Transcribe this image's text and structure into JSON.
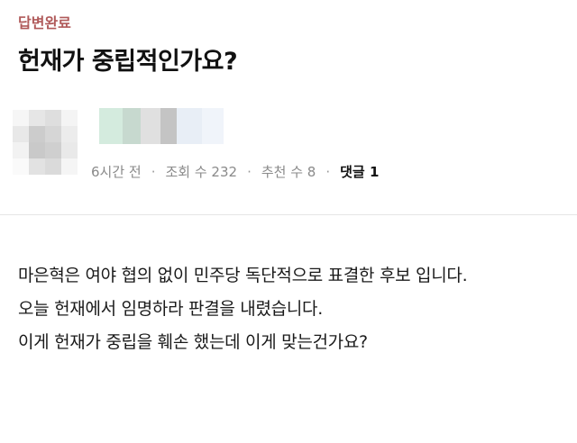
{
  "post": {
    "status_badge": "답변완료",
    "title": "헌재가 중립적인가요?",
    "meta": {
      "time": "6시간 전",
      "views": "조회 수 232",
      "recommends": "추천 수 8",
      "comments": "댓글 1"
    },
    "body": [
      "마은혁은 여야 협의 없이 민주당 독단적으로 표결한 후보 입니다.",
      "오늘 헌재에서 임명하라 판결을 내렸습니다.",
      "이게 헌재가 중립을 훼손 했는데 이게 맞는건가요?"
    ]
  },
  "colors": {
    "status_badge": "#b05a5a",
    "meta_text": "#8a8a8a",
    "avatar_tiles": [
      "#f6f6f6",
      "#e6e6e6",
      "#dedede",
      "#f4f4f4",
      "#e8e8e8",
      "#cccccc",
      "#d6d6d6",
      "#ececec",
      "#f2f2f2",
      "#c9c9c9",
      "#cfcfcf",
      "#e9e9e9",
      "#fafafa",
      "#e2e2e2",
      "#dadada",
      "#f5f5f5"
    ],
    "name_tiles": [
      "#d4ebde",
      "#c7d9cf",
      "#e0e0e0",
      "#c4c4c4",
      "#e8eef6",
      "#f0f4fa"
    ]
  }
}
